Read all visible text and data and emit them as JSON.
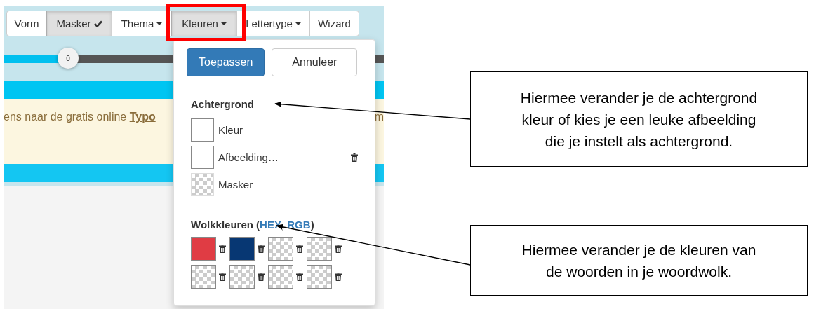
{
  "toolbar": {
    "buttons": [
      {
        "label": "Vorm",
        "selected": false,
        "dropdown": false,
        "checked": false
      },
      {
        "label": "Masker",
        "selected": true,
        "dropdown": false,
        "checked": true
      },
      {
        "label": "Thema",
        "selected": false,
        "dropdown": true,
        "checked": false
      },
      {
        "label": "Kleuren",
        "selected": true,
        "dropdown": true,
        "checked": false
      },
      {
        "label": "Lettertype",
        "selected": false,
        "dropdown": true,
        "checked": false
      },
      {
        "label": "Wizard",
        "selected": false,
        "dropdown": false,
        "checked": false
      }
    ]
  },
  "slider": {
    "reading": "0",
    "level": 0.17
  },
  "banner": {
    "text": "ens naar de gratis online **Typo**",
    "edge_text": "m"
  },
  "dropdown": {
    "apply_button": "Toepassen",
    "cancel_button": "Annuleer",
    "background": {
      "title": "Achtergrond",
      "items": [
        {
          "label": "Kleur",
          "kind": "empty",
          "deletable": false
        },
        {
          "label": "Afbeelding…",
          "kind": "empty",
          "deletable": true
        },
        {
          "label": "Masker",
          "kind": "pattern",
          "deletable": false
        }
      ]
    },
    "cloud_colors": {
      "title": "Wolkkleuren",
      "open": "(",
      "separator": ", ",
      "close": ")",
      "links": [
        "HEX",
        "RGB"
      ],
      "swatches": [
        {
          "kind": "color",
          "color": "#e03c44"
        },
        {
          "kind": "color",
          "color": "#073773"
        },
        {
          "kind": "transparent"
        },
        {
          "kind": "transparent"
        },
        {
          "kind": "transparent"
        },
        {
          "kind": "transparent"
        },
        {
          "kind": "transparent"
        },
        {
          "kind": "transparent"
        }
      ]
    }
  },
  "callouts": [
    {
      "lines": [
        "Hiermee verander je de achtergrond",
        "kleur of kies je een leuke afbeelding",
        "die je instelt als achtergrond."
      ]
    },
    {
      "lines": [
        "Hiermee verander je de kleuren van",
        "de woorden in je woordwolk."
      ]
    }
  ]
}
